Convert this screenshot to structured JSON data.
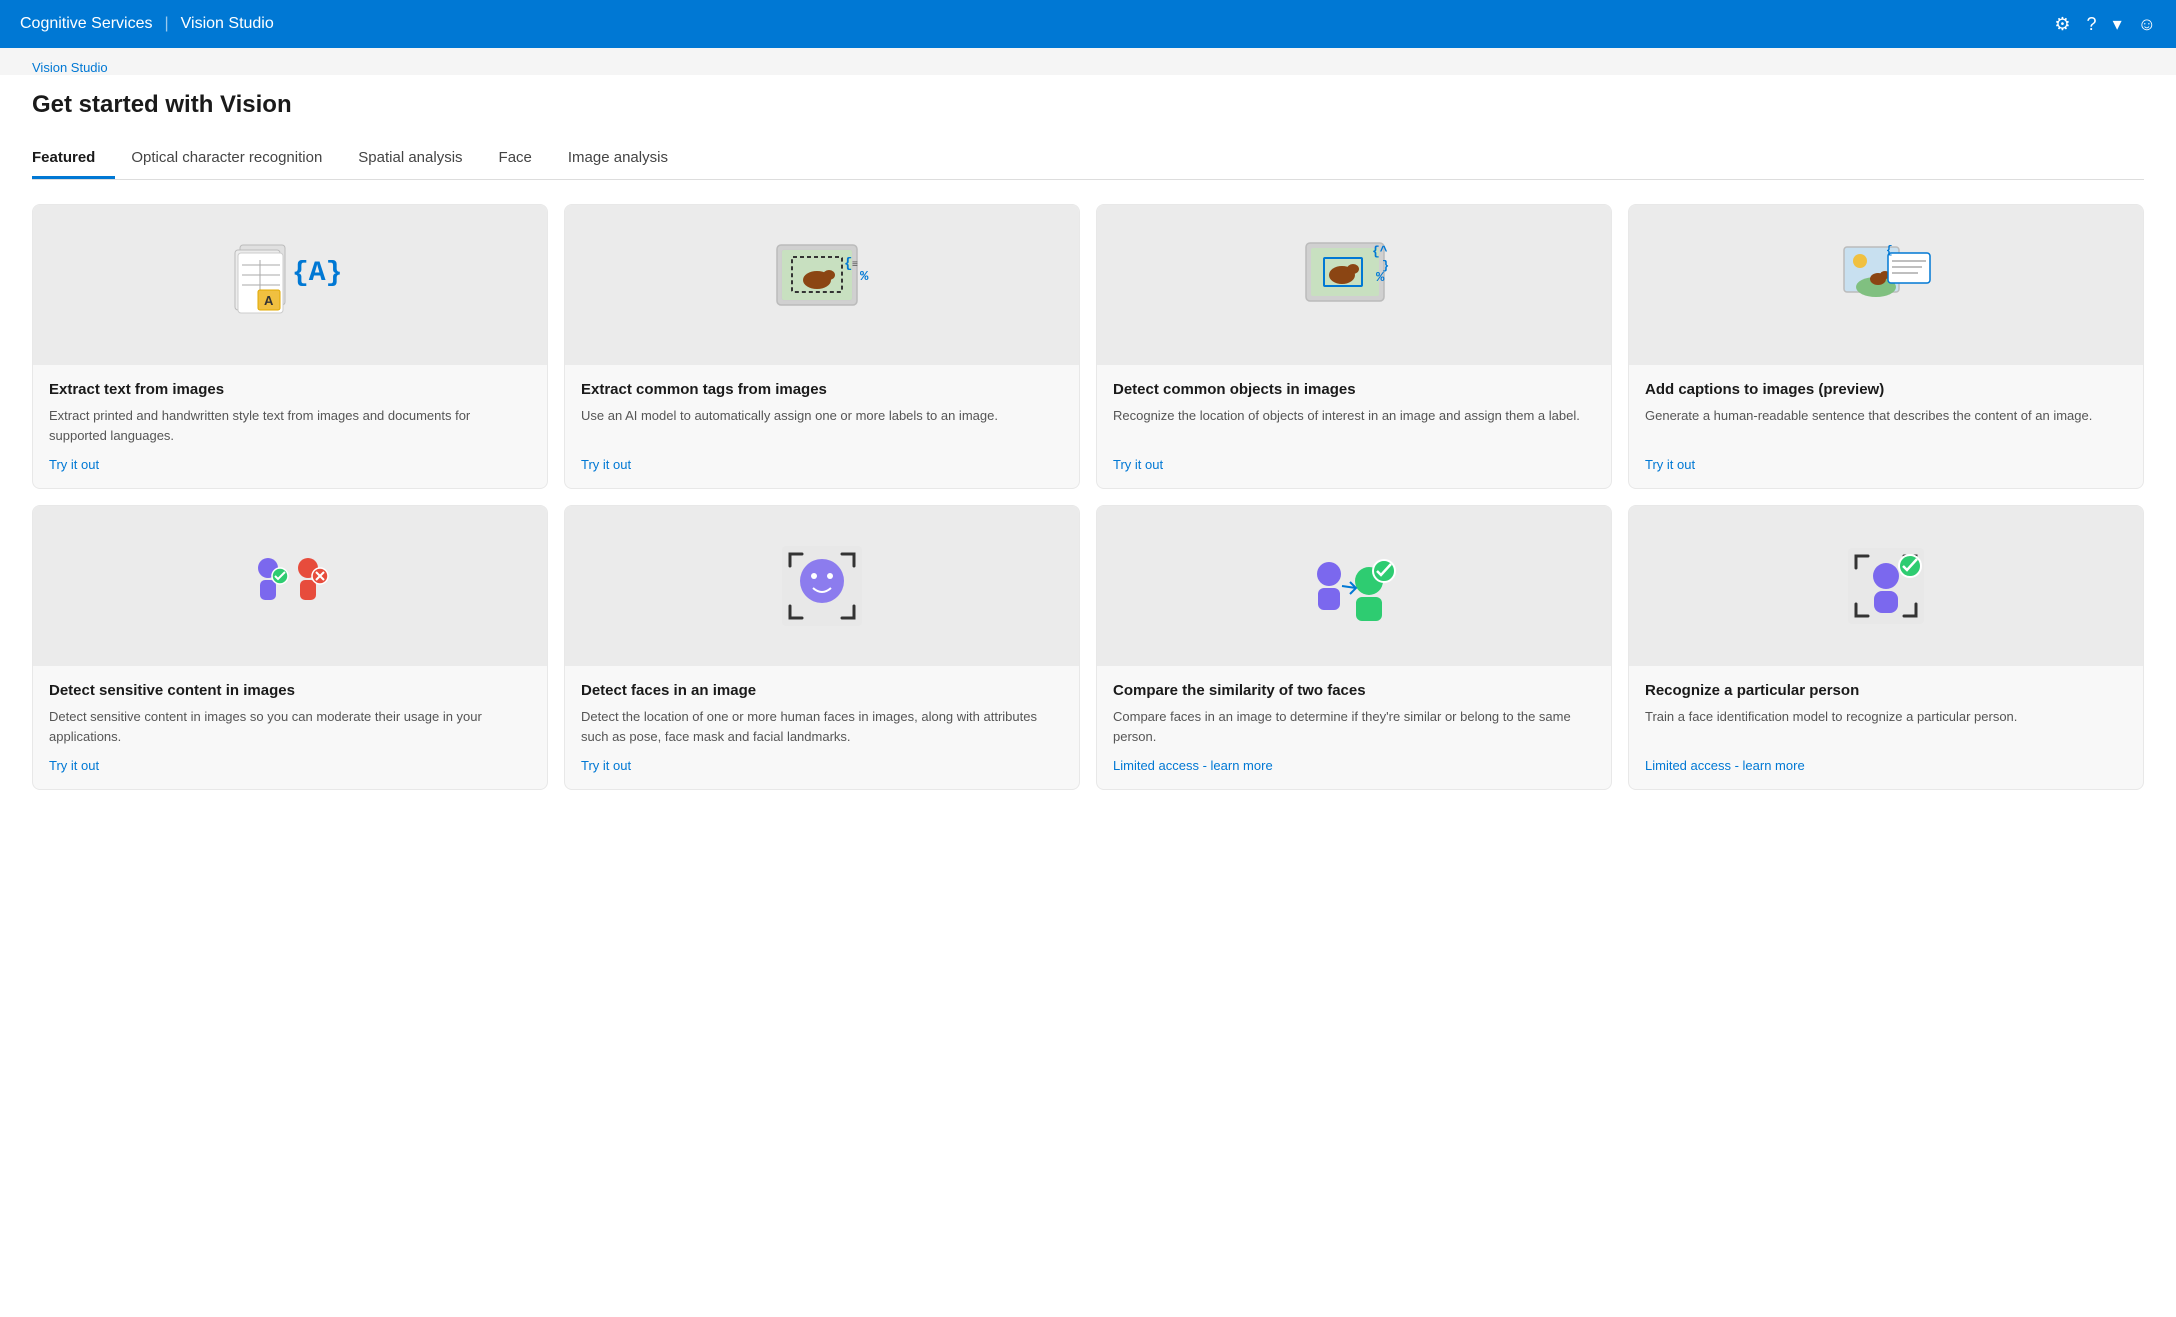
{
  "topNav": {
    "brand": "Cognitive Services",
    "separator": "|",
    "appName": "Vision Studio",
    "icons": {
      "gear": "⚙",
      "question": "?",
      "chevron": "▾",
      "avatar": "☺"
    }
  },
  "breadcrumb": {
    "label": "Vision Studio",
    "href": "#"
  },
  "pageTitle": "Get started with Vision",
  "tabs": [
    {
      "id": "featured",
      "label": "Featured",
      "active": true
    },
    {
      "id": "ocr",
      "label": "Optical character recognition",
      "active": false
    },
    {
      "id": "spatial",
      "label": "Spatial analysis",
      "active": false
    },
    {
      "id": "face",
      "label": "Face",
      "active": false
    },
    {
      "id": "image-analysis",
      "label": "Image analysis",
      "active": false
    }
  ],
  "cards": [
    {
      "id": "extract-text",
      "title": "Extract text from images",
      "desc": "Extract printed and handwritten style text from images and documents for supported languages.",
      "linkLabel": "Try it out",
      "linkType": "tryout",
      "row": 1
    },
    {
      "id": "extract-tags",
      "title": "Extract common tags from images",
      "desc": "Use an AI model to automatically assign one or more labels to an image.",
      "linkLabel": "Try it out",
      "linkType": "tryout",
      "row": 1
    },
    {
      "id": "detect-objects",
      "title": "Detect common objects in images",
      "desc": "Recognize the location of objects of interest in an image and assign them a label.",
      "linkLabel": "Try it out",
      "linkType": "tryout",
      "row": 1
    },
    {
      "id": "add-captions",
      "title": "Add captions to images (preview)",
      "desc": "Generate a human-readable sentence that describes the content of an image.",
      "linkLabel": "Try it out",
      "linkType": "tryout",
      "row": 1
    },
    {
      "id": "detect-sensitive",
      "title": "Detect sensitive content in images",
      "desc": "Detect sensitive content in images so you can moderate their usage in your applications.",
      "linkLabel": "Try it out",
      "linkType": "tryout",
      "row": 2
    },
    {
      "id": "detect-faces",
      "title": "Detect faces in an image",
      "desc": "Detect the location of one or more human faces in images, along with attributes such as pose, face mask and facial landmarks.",
      "linkLabel": "Try it out",
      "linkType": "tryout",
      "row": 2
    },
    {
      "id": "compare-faces",
      "title": "Compare the similarity of two faces",
      "desc": "Compare faces in an image to determine if they're similar or belong to the same person.",
      "linkLabel": "Limited access - learn more",
      "linkType": "limited",
      "row": 2
    },
    {
      "id": "recognize-person",
      "title": "Recognize a particular person",
      "desc": "Train a face identification model to recognize a particular person.",
      "linkLabel": "Limited access - learn more",
      "linkType": "limited",
      "row": 2
    }
  ]
}
